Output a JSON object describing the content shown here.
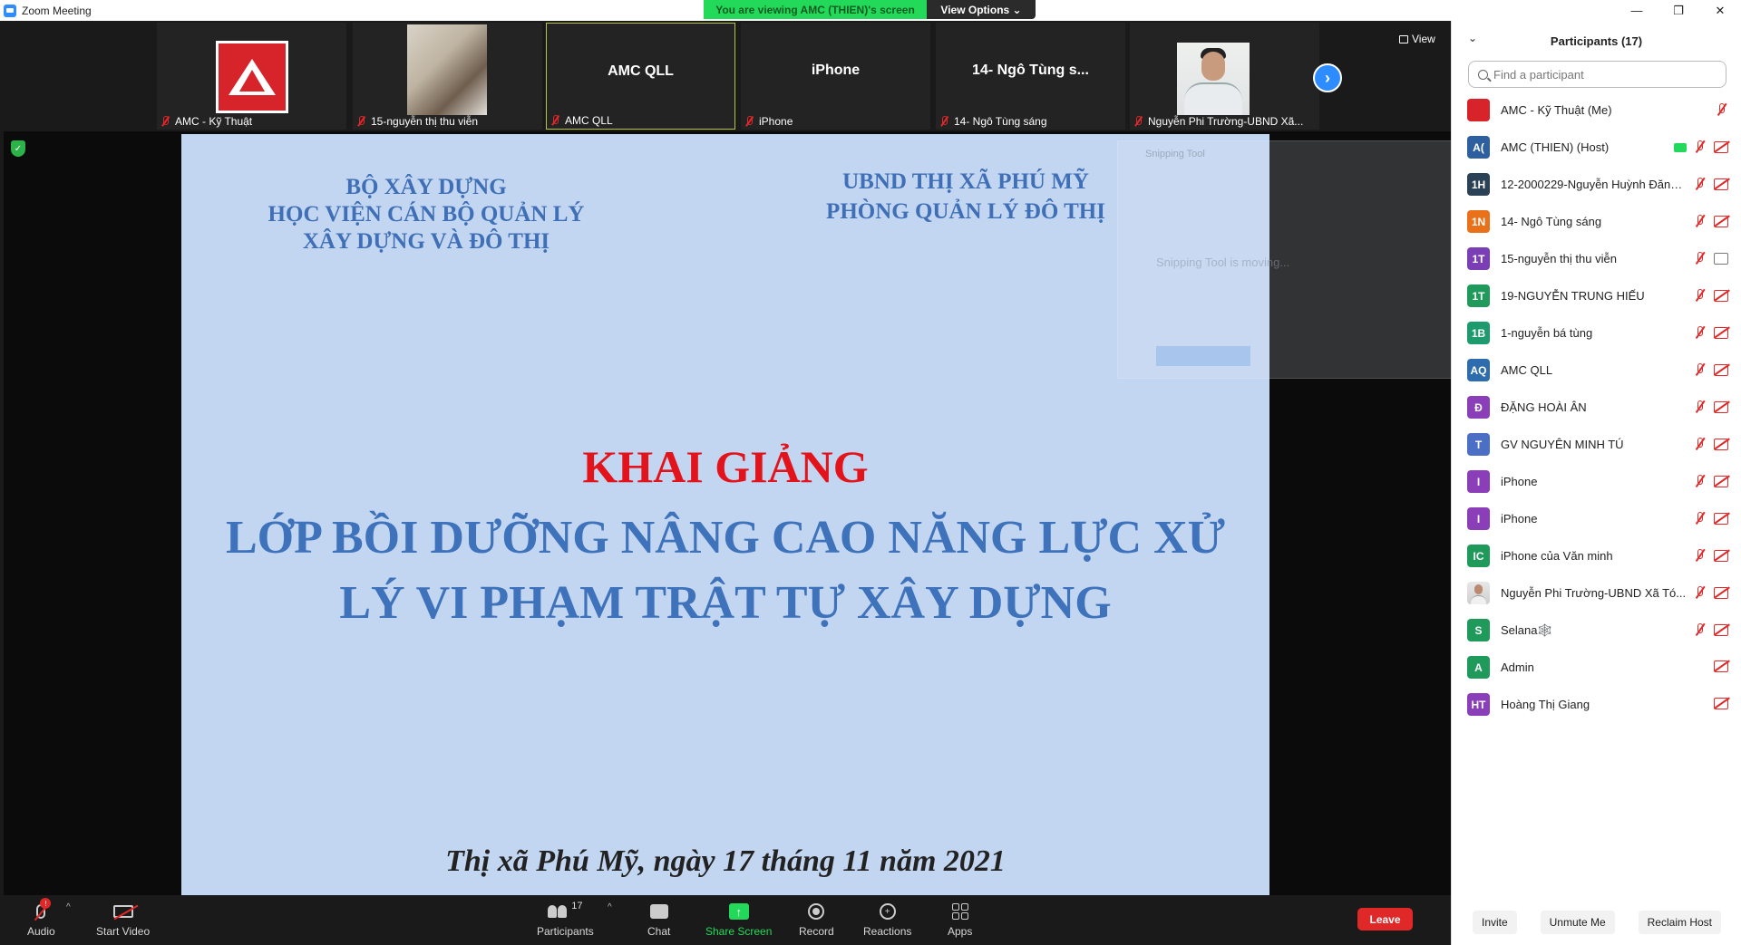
{
  "window": {
    "title": "Zoom Meeting",
    "viewing_banner": "You are viewing AMC (THIEN)'s screen",
    "view_options": "View Options ⌄",
    "minimize": "—",
    "restore": "❐",
    "close": "✕"
  },
  "thumbnails": [
    {
      "name": "AMC - Kỹ Thuật",
      "kind": "logo"
    },
    {
      "name": "15-nguyễn thị thu viễn",
      "kind": "photo-room"
    },
    {
      "name": "AMC QLL",
      "big": "AMC QLL",
      "kind": "text",
      "active": true
    },
    {
      "name": "iPhone",
      "big": "iPhone",
      "kind": "text"
    },
    {
      "name": "14- Ngô Tùng sáng",
      "big": "14- Ngô Tùng s...",
      "kind": "text"
    },
    {
      "name": "Nguyễn Phi Trường-UBND Xã...",
      "kind": "photo-man"
    }
  ],
  "view_button": "View",
  "next_icon": "›",
  "shield_icon": "✓",
  "slide": {
    "org_left": [
      "BỘ XÂY DỰNG",
      "HỌC VIỆN CÁN BỘ QUẢN LÝ",
      "XÂY DỰNG VÀ ĐÔ THỊ"
    ],
    "org_right": [
      "UBND THỊ XÃ PHÚ MỸ",
      "PHÒNG QUẢN LÝ ĐÔ THỊ"
    ],
    "heading": "KHAI GIẢNG",
    "course": [
      "LỚP BỒI DƯỠNG NÂNG CAO NĂNG LỰC XỬ",
      "LÝ VI PHẠM TRẬT TỰ XÂY DỰNG"
    ],
    "date": "Thị xã Phú Mỹ, ngày   17   tháng  11 năm 2021",
    "heading_color": "#e3131b",
    "text_color": "#3e72ba",
    "background": "#c2d6f2"
  },
  "snipping": {
    "title": "Snipping Tool",
    "message": "Snipping Tool is moving..."
  },
  "toolbar": {
    "audio": "Audio",
    "audio_badge": "!",
    "start_video": "Start Video",
    "participants": "Participants",
    "participants_count": "17",
    "chat": "Chat",
    "share_screen": "Share Screen",
    "share_arrow": "↑",
    "record": "Record",
    "reactions": "Reactions",
    "reactions_glyph": "+",
    "apps": "Apps",
    "leave": "Leave",
    "caret": "^",
    "accent_green": "#23d959",
    "leave_color": "#e02828"
  },
  "panel": {
    "title": "Participants (17)",
    "collapse_icon": "⌄",
    "search_placeholder": "Find a participant",
    "participants": [
      {
        "initials": "",
        "name": "AMC - Kỹ Thuật (Me)",
        "color": "#d7232a",
        "avatar": "logo",
        "mic": true,
        "cam": false,
        "share": false
      },
      {
        "initials": "A(",
        "name": "AMC (THIEN) (Host)",
        "color": "#2e5f9e",
        "avatar": "initials",
        "mic": true,
        "cam": true,
        "share": true
      },
      {
        "initials": "1H",
        "name": "12-2000229-Nguyễn Huỳnh Đăng...",
        "color": "#2b4155",
        "avatar": "initials",
        "mic": true,
        "cam": true,
        "share": false
      },
      {
        "initials": "1N",
        "name": "14- Ngô Tùng sáng",
        "color": "#e8711a",
        "avatar": "initials",
        "mic": true,
        "cam": true,
        "share": false
      },
      {
        "initials": "1T",
        "name": "15-nguyễn thị thu viễn",
        "color": "#7b3fb5",
        "avatar": "initials",
        "mic": true,
        "cam": false,
        "camOn": true,
        "share": false
      },
      {
        "initials": "1T",
        "name": "19-NGUYỄN TRUNG HIẾU",
        "color": "#1f9a5b",
        "avatar": "initials",
        "mic": true,
        "cam": true,
        "share": false
      },
      {
        "initials": "1B",
        "name": "1-nguyễn bá tùng",
        "color": "#1e9b6e",
        "avatar": "initials",
        "mic": true,
        "cam": true,
        "share": false
      },
      {
        "initials": "AQ",
        "name": "AMC QLL",
        "color": "#2e6dad",
        "avatar": "initials",
        "mic": true,
        "cam": true,
        "share": false
      },
      {
        "initials": "Đ",
        "name": "ĐẶNG HOÀI ÂN",
        "color": "#8a3fb8",
        "avatar": "initials",
        "mic": true,
        "cam": true,
        "share": false
      },
      {
        "initials": "T",
        "name": "GV NGUYÊN MINH TÚ",
        "color": "#4a6fc4",
        "avatar": "initials",
        "mic": true,
        "cam": true,
        "share": false
      },
      {
        "initials": "I",
        "name": "iPhone",
        "color": "#8a3fb8",
        "avatar": "initials",
        "mic": true,
        "cam": true,
        "share": false
      },
      {
        "initials": "I",
        "name": "iPhone",
        "color": "#8a3fb8",
        "avatar": "initials",
        "mic": true,
        "cam": true,
        "share": false
      },
      {
        "initials": "IC",
        "name": "iPhone của Văn minh",
        "color": "#1f9a5b",
        "avatar": "initials",
        "mic": true,
        "cam": true,
        "share": false
      },
      {
        "initials": "",
        "name": "Nguyễn Phi Trường-UBND Xã Tó...",
        "color": "#dddddd",
        "avatar": "photo",
        "mic": true,
        "cam": true,
        "share": false
      },
      {
        "initials": "S",
        "name": "Selana🕸️",
        "color": "#1f9a5b",
        "avatar": "initials",
        "mic": true,
        "cam": true,
        "share": false
      },
      {
        "initials": "A",
        "name": "Admin",
        "color": "#1f9a5b",
        "avatar": "initials",
        "mic": false,
        "cam": true,
        "share": false
      },
      {
        "initials": "HT",
        "name": "Hoàng Thị Giang",
        "color": "#8a3fb8",
        "avatar": "initials",
        "mic": false,
        "cam": true,
        "share": false
      }
    ],
    "invite": "Invite",
    "unmute_me": "Unmute Me",
    "reclaim_host": "Reclaim Host"
  }
}
